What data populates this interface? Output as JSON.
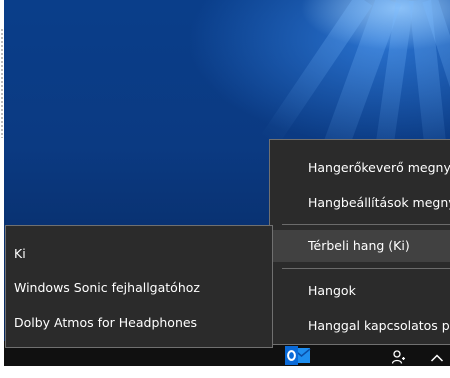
{
  "context_menu": {
    "items": [
      {
        "label": "Hangerőkeverő megnyitása"
      },
      {
        "label": "Hangbeállítások megnyitása"
      },
      {
        "label": "Térbeli hang (Ki)"
      },
      {
        "label": "Hangok"
      },
      {
        "label": "Hanggal kapcsolatos problémák elhárítása"
      }
    ]
  },
  "spatial_sound_submenu": {
    "items": [
      {
        "label": "Ki"
      },
      {
        "label": "Windows Sonic fejhallgatóhoz"
      },
      {
        "label": "Dolby Atmos for Headphones"
      }
    ]
  },
  "taskbar": {
    "icons": [
      "outlook-icon",
      "people-icon",
      "chevron-up-icon"
    ]
  },
  "colors": {
    "menu_background": "#2b2b2b",
    "menu_highlight": "#414141",
    "menu_border": "#707070",
    "taskbar": "#101010",
    "outlook_blue": "#0a6ad8"
  }
}
